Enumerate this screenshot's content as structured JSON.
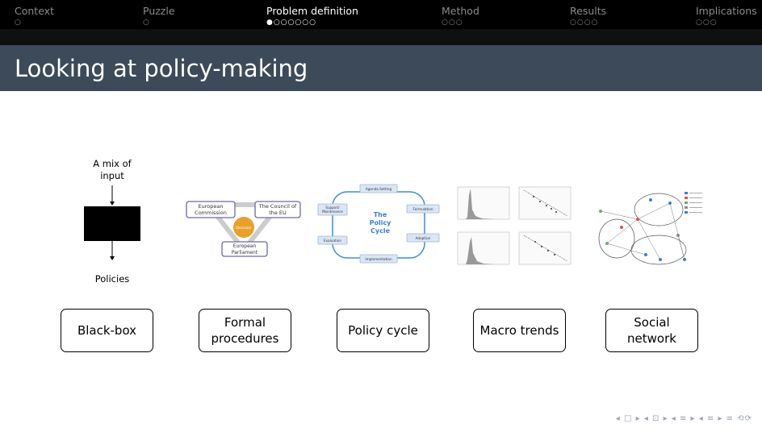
{
  "nav": [
    {
      "label": "Context",
      "dots": "○",
      "active": false
    },
    {
      "label": "Puzzle",
      "dots": "○",
      "active": false
    },
    {
      "label": "Problem definition",
      "dots": "●○○○○○○",
      "active": true
    },
    {
      "label": "Method",
      "dots": "○○○",
      "active": false
    },
    {
      "label": "Results",
      "dots": "○○○○",
      "active": false
    },
    {
      "label": "Implications",
      "dots": "○○○",
      "active": false
    }
  ],
  "title": "Looking at policy-making",
  "blackbox": {
    "input_label_line1": "A mix of",
    "input_label_line2": "input",
    "output_label": "Policies"
  },
  "formal": {
    "commission": "European Commission",
    "council": "The Council of the EU",
    "decision": "Decision",
    "parliament": "European Parliament"
  },
  "cycle": {
    "center": "The Policy Cycle",
    "agenda": "Agenda Setting",
    "formulation": "Formulation",
    "adoption": "Adoption",
    "implementation": "Implementation",
    "evaluation": "Evaluation",
    "support": "Support/ Maintenance"
  },
  "boxes": {
    "blackbox": "Black-box",
    "formal_line1": "Formal",
    "formal_line2": "procedures",
    "policy_cycle": "Policy cycle",
    "macro": "Macro trends",
    "social_line1": "Social",
    "social_line2": "network"
  },
  "footer": "◂ □ ▸ ◂ ⊡ ▸ ◂ ≡ ▸ ◂ ≡ ▸   ≡   ⟲⟳"
}
